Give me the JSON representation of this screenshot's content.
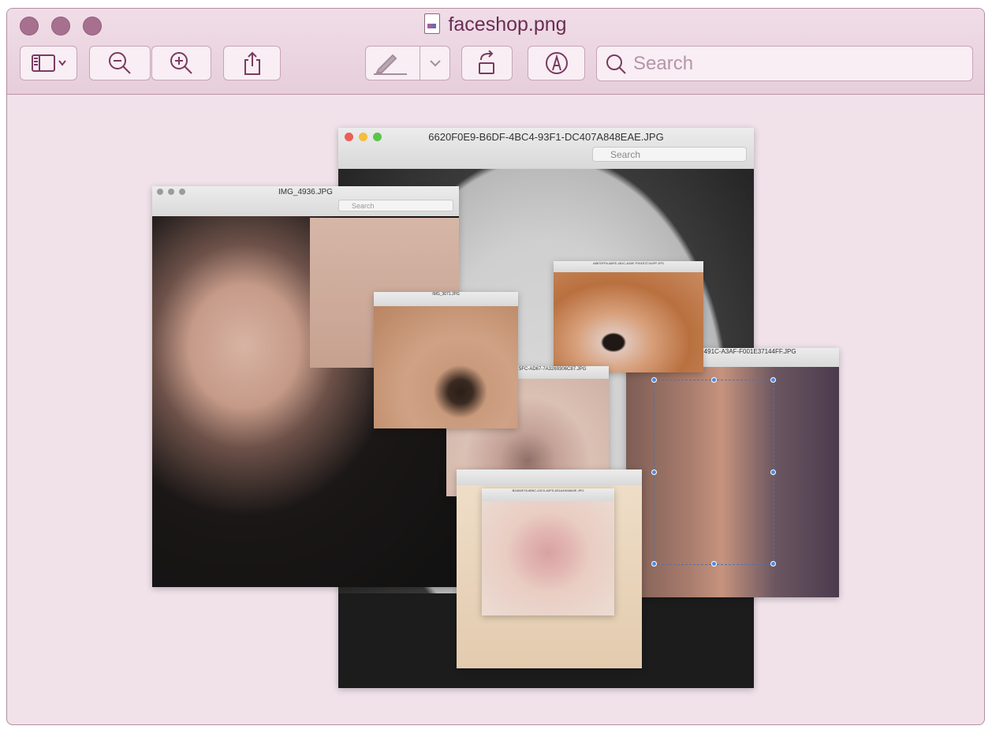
{
  "window": {
    "title": "faceshop.png",
    "search_placeholder": "Search"
  },
  "toolbar": {
    "sidebar_icon": "sidebar-icon",
    "zoom_out_icon": "zoom-out-icon",
    "zoom_in_icon": "zoom-in-icon",
    "share_icon": "share-icon",
    "markup_icon": "markup-pen-icon",
    "rotate_icon": "rotate-icon",
    "annotate_icon": "annotate-icon"
  },
  "collage": {
    "back_window_title": "6620F0E9-B6DF-4BC4-93F1-DC407A848EAE.JPG",
    "ear_window_title": "IMG_4936.JPG",
    "eye_window_title": "IMG_3671.JPG",
    "eyelid_window_title": "A8670FFA-8AFE-481C-A3AF-F001E37144FF.JPG",
    "right_window_title": "-491C-A3AF-F001E37144FF.JPG",
    "nose_window_title": "5FC-AD67-7A3269306C87.JPG",
    "lips_window_title": "B2A54E78-6B6C-43C0-A0FD-831A4904862E.JPG",
    "search_placeholder": "Search"
  },
  "colors": {
    "accent": "#7a3a62",
    "window_bg": "#f1e2ea",
    "traffic_light": "#a7708f"
  }
}
